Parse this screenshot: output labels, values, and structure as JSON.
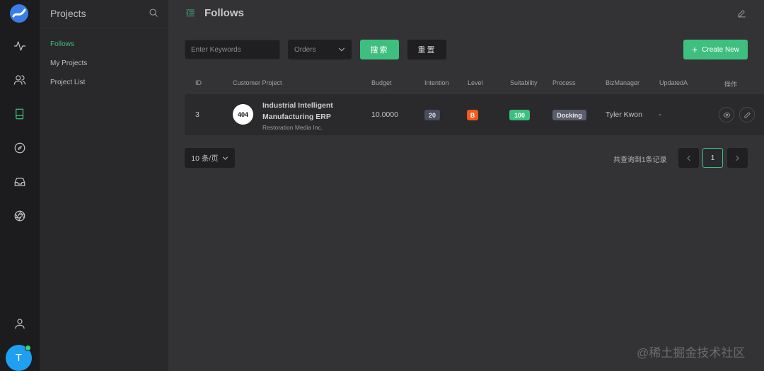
{
  "rail": {
    "icons": [
      "activity-icon",
      "users-icon",
      "book-icon",
      "compass-icon",
      "inbox-icon",
      "aperture-icon",
      "user-icon"
    ],
    "active": "book-icon",
    "avatar_initial": "T"
  },
  "sidebar": {
    "title": "Projects",
    "items": [
      {
        "label": "Follows",
        "active": true
      },
      {
        "label": "My Projects",
        "active": false
      },
      {
        "label": "Project List",
        "active": false
      }
    ]
  },
  "header": {
    "title": "Follows"
  },
  "filters": {
    "keyword_placeholder": "Enter Keywords",
    "keyword_value": "",
    "orders_label": "Orders",
    "search_label": "搜索",
    "reset_label": "重置",
    "create_label": "Create New"
  },
  "table": {
    "columns": [
      "ID",
      "Customer Project",
      "Budget",
      "Intention",
      "Level",
      "Suitability",
      "Process",
      "BizManager",
      "UpdatedA",
      "操作"
    ],
    "rows": [
      {
        "id": "3",
        "project_logo": "404",
        "project_name": "Industrial Intelligent Manufacturing ERP",
        "company": "Restoration Media Inc.",
        "budget": "10.0000",
        "intention": "20",
        "level": "B",
        "suitability": "100",
        "process": "Docking",
        "biz_manager": "Tyler Kwon",
        "updated": "-"
      }
    ]
  },
  "pagination": {
    "page_size": "10 条/页",
    "total_text": "共查询到1条记录",
    "current_page": "1"
  },
  "colors": {
    "accent": "#3fbf7f",
    "intention_badge": "#4a4d5e",
    "level_badge": "#f05a1a",
    "suitability_badge": "#3fbf7f",
    "process_badge": "#5a5d6c"
  },
  "watermark": "@稀土掘金技术社区"
}
